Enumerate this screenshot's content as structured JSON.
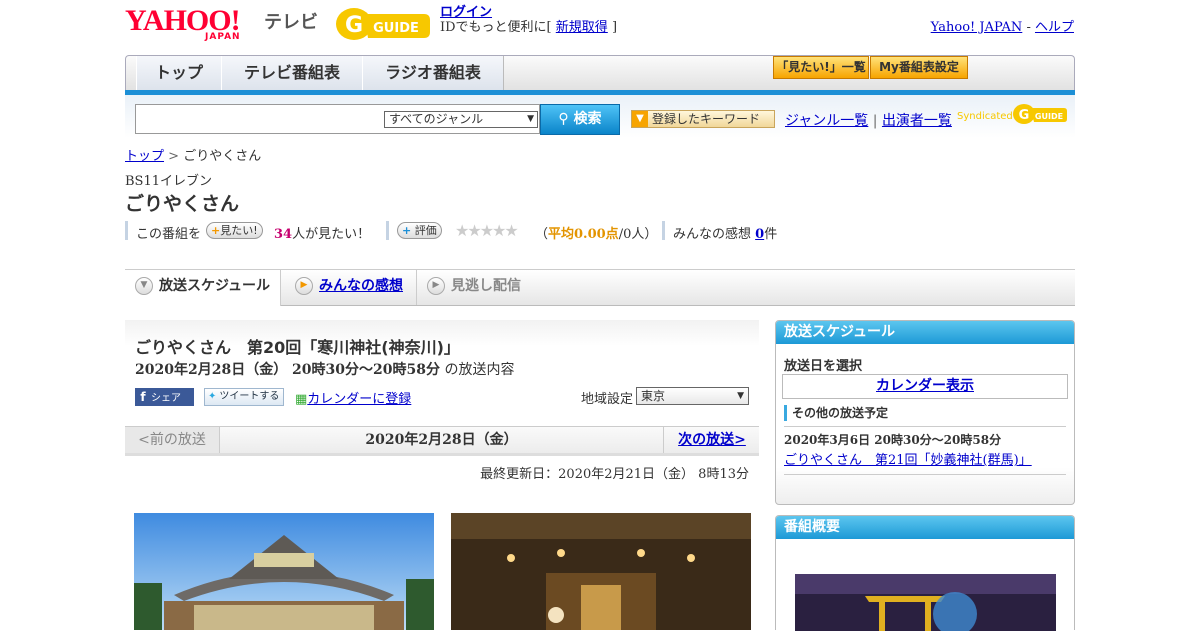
{
  "header": {
    "logo_text": "YAHOO!",
    "logo_japan": "JAPAN",
    "tv_label": "テレビ",
    "gguide_label": "G-GUIDE",
    "login_link": "ログイン",
    "login_sub_prefix": "IDでもっと便利に[",
    "register_link": "新規取得",
    "login_sub_suffix": "]",
    "yahoo_japan_link": "Yahoo! JAPAN",
    "dash": "-",
    "help_link": "ヘルプ"
  },
  "nav": {
    "tabs": [
      {
        "label": "トップ"
      },
      {
        "label": "テレビ番組表"
      },
      {
        "label": "ラジオ番組表"
      }
    ],
    "mitai_list_btn": "「見たい!」一覧",
    "my_schedule_btn": "My番組表設定"
  },
  "search": {
    "input_value": "",
    "genre_selected": "すべてのジャンル",
    "search_btn": "検索",
    "keyword_btn": "登録したキーワード",
    "genre_list_link": "ジャンル一覧",
    "sep": "|",
    "cast_list_link": "出演者一覧",
    "syndicated": "Syndicated"
  },
  "breadcrumb": {
    "top": "トップ",
    "sep": ">",
    "current": "ごりやくさん"
  },
  "program": {
    "station": "BS11イレブン",
    "title": "ごりやくさん",
    "this_program": "この番組を",
    "mitai_btn": "見たい!",
    "mitai_count": "34",
    "mitai_suffix": "人が見たい！",
    "rate_btn": "評価",
    "stars": "★★★★★",
    "avg_open": "（",
    "avg_label": "平均0.00点",
    "avg_count": "/0人）",
    "impressions_label": "みんなの感想",
    "impressions_count": "0",
    "impressions_suffix": "件"
  },
  "tabs": [
    {
      "label": "放送スケジュール"
    },
    {
      "label": "みんなの感想"
    },
    {
      "label": "見逃し配信"
    }
  ],
  "episode": {
    "title": "ごりやくさん　第20回「寒川神社(神奈川)」",
    "date": "2020年2月28日（金） 20時30分～20時58分",
    "date_suffix": "の放送内容",
    "share_btn": "シェア",
    "tweet_btn": "ツイートする",
    "calendar_link": "カレンダーに登録",
    "region_label": "地域設定",
    "region_value": "東京"
  },
  "pager": {
    "prev": "<前の放送",
    "current": "2020年2月28日（金）",
    "next": "次の放送>"
  },
  "updated": "最終更新日：2020年2月21日（金） 8時13分",
  "sidebar": {
    "schedule_title": "放送スケジュール",
    "select_date": "放送日を選択",
    "calendar_btn": "カレンダー表示",
    "other_title": "その他の放送予定",
    "other_date": "2020年3月6日 20時30分～20時58分",
    "other_link": "ごりやくさん　第21回「妙義神社(群馬)」",
    "overview_title": "番組概要"
  },
  "colors": {
    "brand_red": "#ff0033",
    "accent_blue": "#1c8fd6",
    "link": "#0000cc",
    "highlight_pink": "#c6006f",
    "orange": "#f7a400"
  }
}
